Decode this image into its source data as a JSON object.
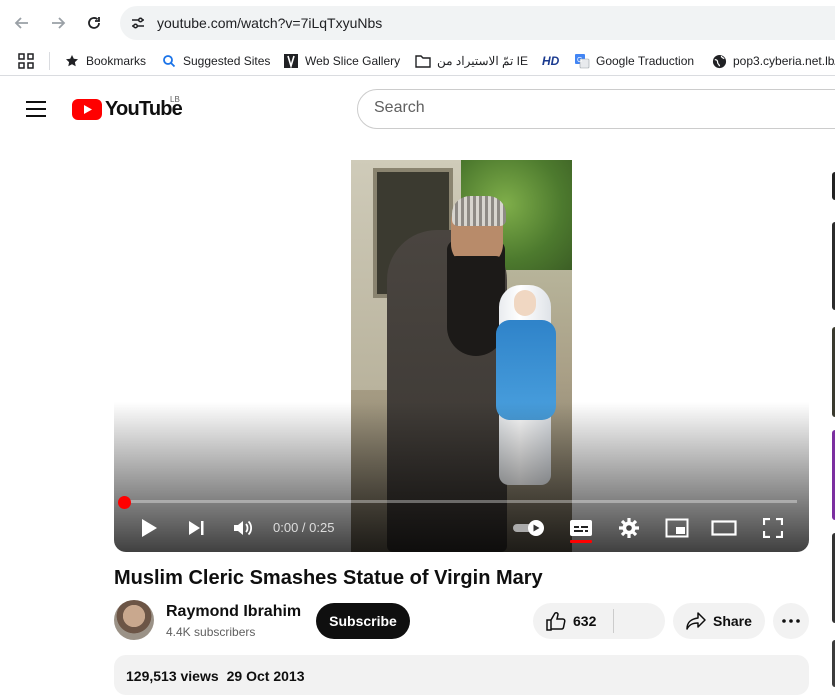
{
  "browser": {
    "url": "youtube.com/watch?v=7iLqTxyuNbs",
    "bookmarks": [
      {
        "label": "Bookmarks",
        "icon": "star-icon"
      },
      {
        "label": "Suggested Sites",
        "icon": "search-icon"
      },
      {
        "label": "Web Slice Gallery",
        "icon": "slice-icon"
      },
      {
        "label": "تمّ الاستيراد من IE",
        "icon": "folder-icon"
      },
      {
        "label": "HD",
        "icon": "hd-icon"
      },
      {
        "label": "Google Traduction",
        "icon": "translate-icon"
      },
      {
        "label": "pop3.cyberia.net.lb/",
        "icon": "globe-icon"
      }
    ]
  },
  "youtube": {
    "logo_text": "YouTube",
    "country_code": "LB",
    "search_placeholder": "Search"
  },
  "player": {
    "time": "0:00 / 0:25",
    "progress_fraction": 0,
    "accent": "#ff0000"
  },
  "video": {
    "title": "Muslim Cleric Smashes Statue of Virgin Mary",
    "channel": "Raymond Ibrahim",
    "subscribers": "4.4K subscribers",
    "subscribe_label": "Subscribe",
    "likes": "632",
    "share_label": "Share",
    "views": "129,513 views",
    "date": "29 Oct 2013"
  }
}
